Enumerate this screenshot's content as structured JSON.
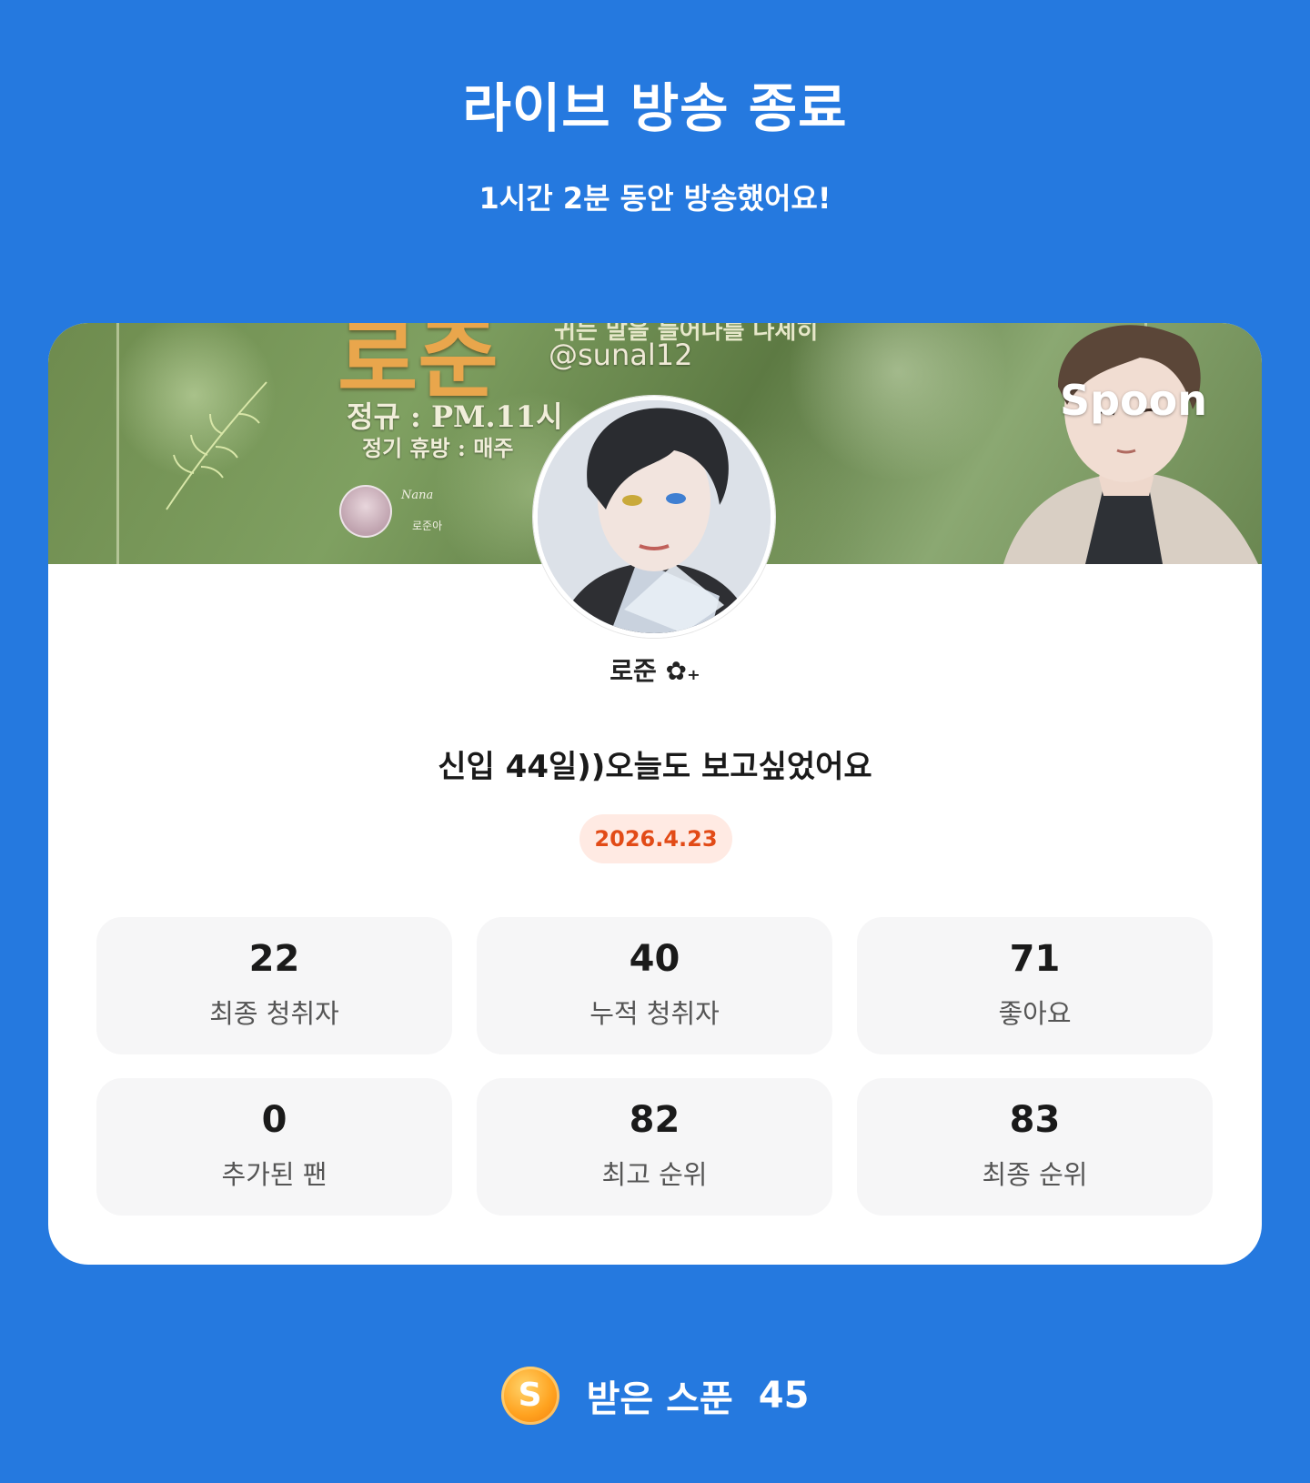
{
  "header": {
    "title": "라이브 방송 종료",
    "subtitle": "1시간 2분 동안 방송했어요!"
  },
  "card": {
    "banner": {
      "big_text": "로준",
      "top_line": "귀는 말을 들어나를 나세히",
      "handle": "@sunal12",
      "schedule_line1": "정규 : PM.11시",
      "schedule_line2": "정기 휴방 : 매주",
      "mini_name": "Nana",
      "mini_sub": "로준아",
      "brand": "Spoon"
    },
    "nickname": "로준 ✿₊",
    "broadcast_title": "신입 44일))오늘도 보고싶었어요",
    "date": "2026.4.23",
    "stats": [
      {
        "value": "22",
        "label": "최종 청취자"
      },
      {
        "value": "40",
        "label": "누적 청취자"
      },
      {
        "value": "71",
        "label": "좋아요"
      },
      {
        "value": "0",
        "label": "추가된 팬"
      },
      {
        "value": "82",
        "label": "최고 순위"
      },
      {
        "value": "83",
        "label": "최종 순위"
      }
    ]
  },
  "spoons": {
    "coin_letter": "S",
    "label": "받은 스푼",
    "count": "45"
  },
  "colors": {
    "background": "#2579DF",
    "date_badge_bg": "#FFEAE3",
    "date_badge_text": "#E24B17",
    "stat_bg": "#F6F6F7",
    "coin": "#FFA21F"
  },
  "icons": {
    "spoon_coin": "spoon-coin-icon",
    "nickname_decoration": "flower-icon"
  }
}
